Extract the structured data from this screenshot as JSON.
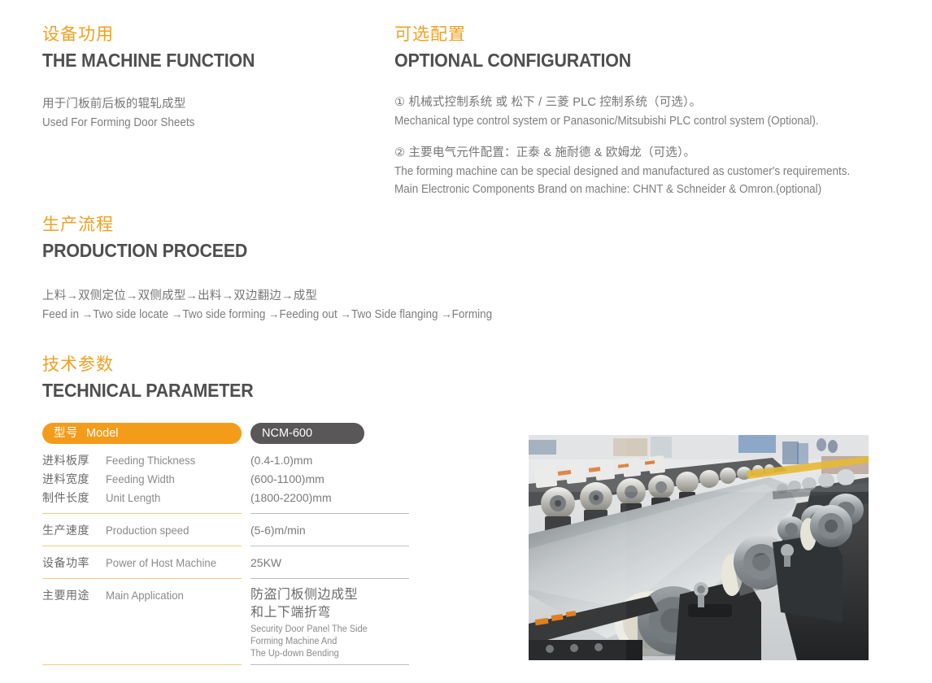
{
  "sections": {
    "machine_function": {
      "title_cn": "设备功用",
      "title_en": "THE MACHINE FUNCTION",
      "desc_cn": "用于门板前后板的辊轧成型",
      "desc_en": "Used For Forming Door Sheets"
    },
    "optional_configuration": {
      "title_cn": "可选配置",
      "title_en": "OPTIONAL CONFIGURATION",
      "item1_cn": "① 机械式控制系统 或 松下 / 三菱 PLC 控制系统（可选）。",
      "item1_en": "Mechanical type control system or Panasonic/Mitsubishi PLC control system (Optional).",
      "item2_cn": "② 主要电气元件配置：正泰 & 施耐德 & 欧姆龙（可选）。",
      "item2_en_line1": "The forming machine can be special designed and manufactured as customer's requirements.",
      "item2_en_line2": "Main Electronic Components Brand on machine: CHNT & Schneider & Omron.(optional)"
    },
    "production_proceed": {
      "title_cn": "生产流程",
      "title_en": "PRODUCTION PROCEED",
      "flow_cn": "上料→双侧定位→双侧成型→出料→双边翻边→成型",
      "flow_en": "Feed in →Two side locate  →Two side forming  →Feeding out  →Two Side flanging  →Forming"
    },
    "technical_parameter": {
      "title_cn": "技术参数",
      "title_en": "TECHNICAL PARAMETER"
    }
  },
  "spec_table": {
    "header": {
      "label_cn": "型号",
      "label_en": "Model",
      "value": "NCM-600"
    },
    "rows": [
      {
        "cn": "进料板厚",
        "en": "Feeding Thickness",
        "value": "(0.4-1.0)mm"
      },
      {
        "cn": "进料宽度",
        "en": "Feeding Width",
        "value": "(600-1100)mm"
      },
      {
        "cn": "制件长度",
        "en": "Unit Length",
        "value": "(1800-2200)mm"
      },
      {
        "cn": "生产速度",
        "en": "Production speed",
        "value": "(5-6)m/min"
      },
      {
        "cn": "设备功率",
        "en": "Power of Host Machine",
        "value": "25KW"
      }
    ],
    "application_row": {
      "cn": "主要用途",
      "en": "Main Application",
      "value_cn_line1": "防盗门板侧边成型",
      "value_cn_line2": "和上下端折弯",
      "value_en_line1": "Security Door Panel The Side",
      "value_en_line2": "Forming Machine And",
      "value_en_line3": "The Up-down Bending"
    }
  },
  "photo": {
    "alt": "Roll forming machine production line with rollers forming a steel sheet"
  },
  "colors": {
    "accent_orange": "#F0A022",
    "pill_orange": "#F39C1A",
    "pill_dark": "#595757",
    "heading_gray": "#4f4f4f",
    "body_gray": "#757575",
    "rule_orange": "#F7C97A",
    "rule_gray": "#B9BDC1"
  }
}
